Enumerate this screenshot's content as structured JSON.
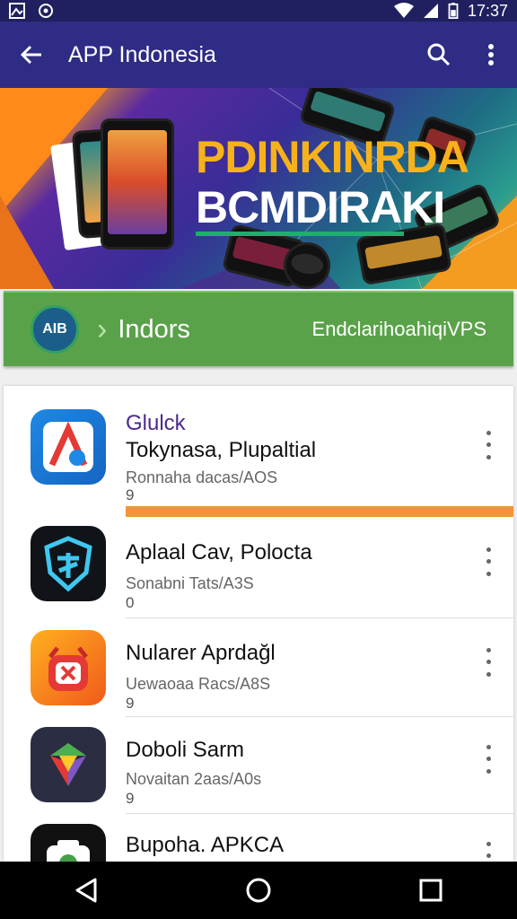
{
  "status_bar": {
    "time": "17:37"
  },
  "app_bar": {
    "title": "APP Indonesia"
  },
  "banner": {
    "headline": "PDINKINRDA",
    "subheadline": "BCMDIRAKI"
  },
  "category": {
    "badge": "AIB",
    "label": "Indors",
    "right_text": "EndclarihoahiqiVPS"
  },
  "apps": [
    {
      "tag": "Glulck",
      "name": "Tokynasa, Plupaltial",
      "sub": "Ronnaha dacas/AOS",
      "num": "9",
      "progress": 1.0
    },
    {
      "name": "Aplaal Cav, Polocta",
      "sub": "Sonabni Tats/A3S",
      "num": "0"
    },
    {
      "name": "Nularer Aprdağl",
      "sub": "Uewaoaa Racs/A8S",
      "num": "9"
    },
    {
      "name": "Doboli Sarm",
      "sub": "Novaitan 2aas/A0s",
      "num": "9"
    },
    {
      "name": "Bupoha. APKCA",
      "sub": "",
      "num": ""
    }
  ],
  "colors": {
    "accent": "#2e2c84",
    "category": "#5aa24a",
    "progress": "#f0963a"
  },
  "icons": [
    "back-arrow-icon",
    "search-icon",
    "more-vert-icon",
    "nav-back-icon",
    "nav-home-icon",
    "nav-recents-icon"
  ]
}
